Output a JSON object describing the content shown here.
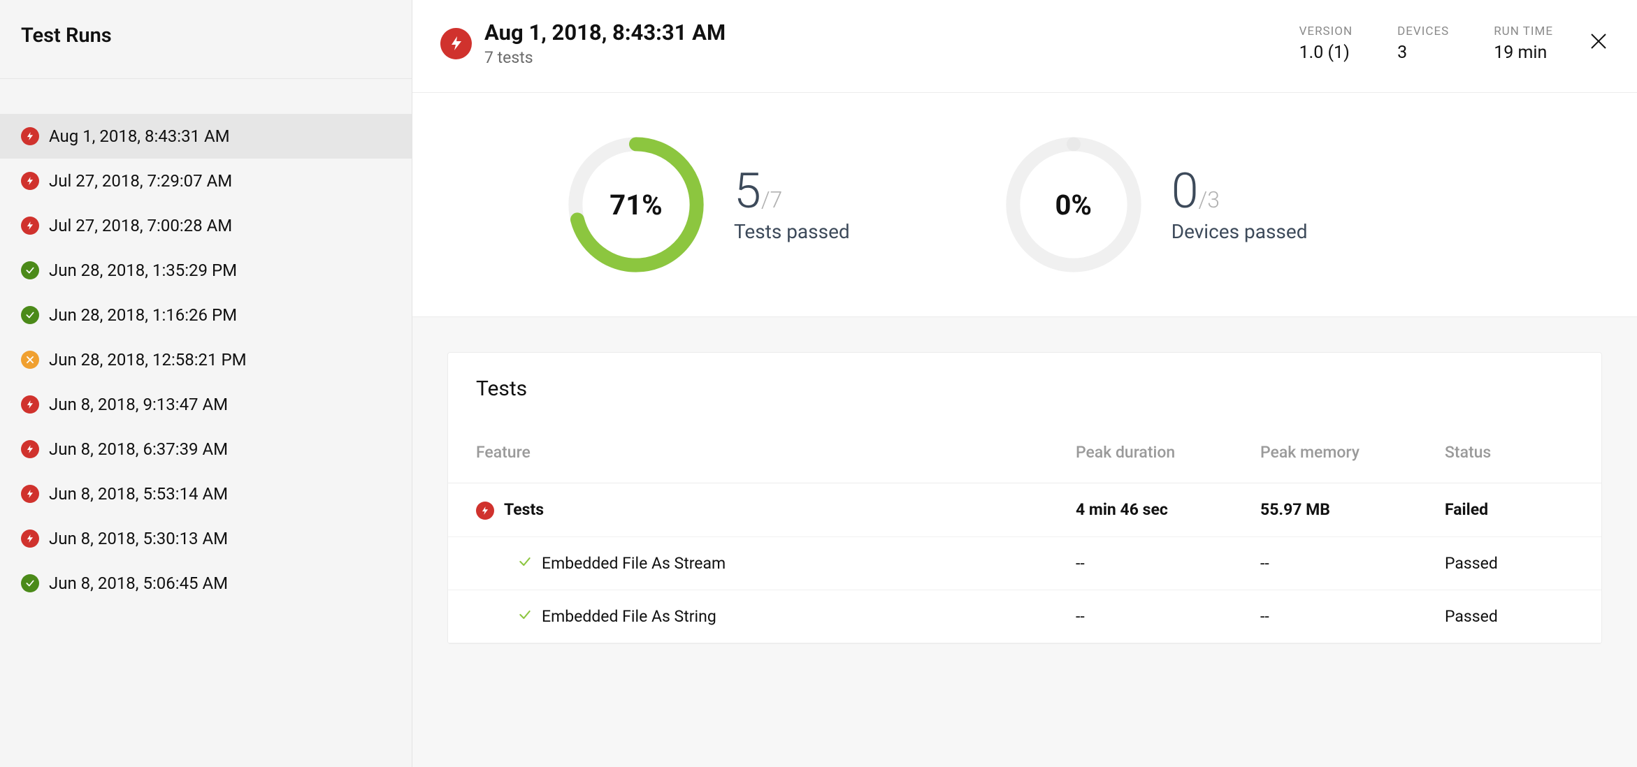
{
  "sidebar": {
    "title": "Test Runs",
    "items": [
      {
        "label": "Aug 1, 2018, 8:43:31 AM",
        "status": "fail",
        "selected": true
      },
      {
        "label": "Jul 27, 2018, 7:29:07 AM",
        "status": "fail",
        "selected": false
      },
      {
        "label": "Jul 27, 2018, 7:00:28 AM",
        "status": "fail",
        "selected": false
      },
      {
        "label": "Jun 28, 2018, 1:35:29 PM",
        "status": "pass",
        "selected": false
      },
      {
        "label": "Jun 28, 2018, 1:16:26 PM",
        "status": "pass",
        "selected": false
      },
      {
        "label": "Jun 28, 2018, 12:58:21 PM",
        "status": "warn",
        "selected": false
      },
      {
        "label": "Jun 8, 2018, 9:13:47 AM",
        "status": "fail",
        "selected": false
      },
      {
        "label": "Jun 8, 2018, 6:37:39 AM",
        "status": "fail",
        "selected": false
      },
      {
        "label": "Jun 8, 2018, 5:53:14 AM",
        "status": "fail",
        "selected": false
      },
      {
        "label": "Jun 8, 2018, 5:30:13 AM",
        "status": "fail",
        "selected": false
      },
      {
        "label": "Jun 8, 2018, 5:06:45 AM",
        "status": "pass",
        "selected": false
      }
    ]
  },
  "header": {
    "title": "Aug 1, 2018, 8:43:31 AM",
    "subtitle": "7 tests",
    "status": "fail",
    "meta": {
      "version_label": "VERSION",
      "version_value": "1.0 (1)",
      "devices_label": "DEVICES",
      "devices_value": "3",
      "runtime_label": "RUN TIME",
      "runtime_value": "19 min"
    }
  },
  "summary": {
    "tests": {
      "percent": 71,
      "pass": 5,
      "total": 7,
      "label": "Tests passed",
      "color": "#8CC63F"
    },
    "devices": {
      "percent": 0,
      "pass": 0,
      "total": 3,
      "label": "Devices passed",
      "color": "#e9e9e9"
    }
  },
  "tests_section": {
    "title": "Tests",
    "columns": {
      "feature": "Feature",
      "peak_duration": "Peak duration",
      "peak_memory": "Peak memory",
      "status": "Status"
    },
    "rows": [
      {
        "type": "parent",
        "status": "fail",
        "feature": "Tests",
        "peak_duration": "4 min 46 sec",
        "peak_memory": "55.97 MB",
        "result": "Failed"
      },
      {
        "type": "child",
        "status": "pass",
        "feature": "Embedded File As Stream",
        "peak_duration": "--",
        "peak_memory": "--",
        "result": "Passed"
      },
      {
        "type": "child",
        "status": "pass",
        "feature": "Embedded File As String",
        "peak_duration": "--",
        "peak_memory": "--",
        "result": "Passed"
      }
    ]
  },
  "chart_data": [
    {
      "type": "pie",
      "title": "Tests passed",
      "categories": [
        "passed",
        "remaining"
      ],
      "values": [
        71,
        29
      ],
      "xlabel": "",
      "ylabel": "",
      "center_label": "71%",
      "fraction": "5/7"
    },
    {
      "type": "pie",
      "title": "Devices passed",
      "categories": [
        "passed",
        "remaining"
      ],
      "values": [
        0,
        100
      ],
      "xlabel": "",
      "ylabel": "",
      "center_label": "0%",
      "fraction": "0/3"
    }
  ]
}
